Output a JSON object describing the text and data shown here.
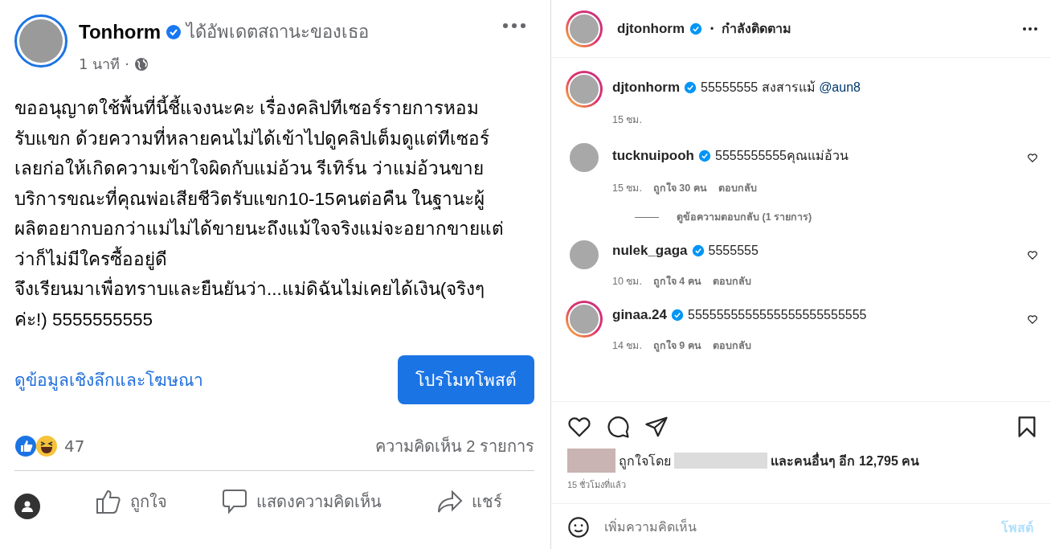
{
  "fb_post": {
    "author": "Tonhorm",
    "verified": true,
    "action": "ได้อัพเดตสถานะของเธอ",
    "time": "1 นาที",
    "time_separator": "·",
    "body": "ขออนุญาตใช้พื้นที่นี้ชี้แจงนะคะ เรื่องคลิปทีเซอร์รายการหอมรับแขก ด้วยความที่หลายคนไม่ได้เข้าไปดูคลิปเต็มดูแต่ทีเซอร์เลยก่อให้เกิดความเข้าใจผิดกับแม่อ้วน รีเทิร์น ว่าแม่อ้วนขายบริการขณะที่คุณพ่อเสียชีวิตรับแขก10-15คนต่อคืน ในฐานะผู้ผลิตอยากบอกว่าแม่ไม่ได้ขายนะถึงแม้ใจจริงแม่จะอยากขายแต่ว่าก็ไม่มีใครซื้ออยู่ดี\nจึงเรียนมาเพื่อทราบและยืนยันว่า...แม่ดิฉันไม่เคยได้เงิน(จริงๆค่ะ!) 5555555555",
    "insights_link": "ดูข้อมูลเชิงลึกและโฆษณา",
    "promote_button": "โปรโมทโพสต์",
    "reaction_count": "47",
    "comment_count": "ความคิดเห็น 2 รายการ",
    "actions": [
      {
        "kind": "like",
        "label": "ถูกใจ"
      },
      {
        "kind": "comment",
        "label": "แสดงความคิดเห็น"
      },
      {
        "kind": "share",
        "label": "แชร์"
      }
    ]
  },
  "ig_post": {
    "username": "djtonhorm",
    "verified": true,
    "name_separator": "•",
    "follow_status": "กำลังติดตาม",
    "comments": [
      {
        "username": "djtonhorm",
        "verified": true,
        "story_ring": true,
        "text": "55555555 สงสารแม้ ",
        "mention": "@aun8",
        "time": "15 ชม.",
        "heart": false
      },
      {
        "username": "tucknuipooh",
        "verified": true,
        "story_ring": false,
        "text": "5555555555คุณแม่อ้วน",
        "time": "15 ชม.",
        "likes": "ถูกใจ 30 คน",
        "reply": "ตอบกลับ",
        "heart": true,
        "view_replies": "ดูข้อความตอบกลับ (1 รายการ)"
      },
      {
        "username": "nulek_gaga",
        "verified": true,
        "story_ring": false,
        "text": "5555555",
        "time": "10 ชม.",
        "likes": "ถูกใจ 4 คน",
        "reply": "ตอบกลับ",
        "heart": true
      },
      {
        "username": "ginaa.24",
        "verified": true,
        "story_ring": true,
        "text": "5555555555555555555555555",
        "time": "14 ชม.",
        "likes": "ถูกใจ 9 คน",
        "reply": "ตอบกลับ",
        "heart": true
      }
    ],
    "liked_by_prefix": "ถูกใจโดย",
    "liked_by_suffix": "และคนอื่นๆ อีก 12,795 คน",
    "posted_ago": "15 ชั่วโมงที่แล้ว",
    "comment_placeholder": "เพิ่มความคิดเห็น",
    "post_button": "โพสต์"
  }
}
